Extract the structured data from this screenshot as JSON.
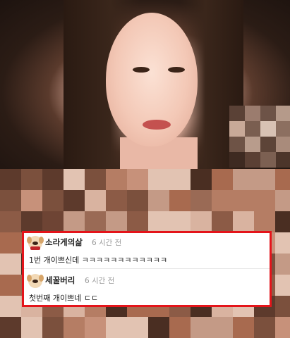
{
  "comments": [
    {
      "username": "소라게의삶",
      "time": "6 시간 전",
      "text": "1번 개이쁘신데 ㅋㅋㅋㅋㅋㅋㅋㅋㅋㅋㅋㅋ"
    },
    {
      "username": "세꿀버리",
      "time": "6 시간 전",
      "text": "첫번째 개이쁘네 ㄷㄷ"
    }
  ],
  "colors": {
    "highlight_border": "#e4141a",
    "comment_bg": "#ffffff",
    "timestamp": "#999999"
  },
  "icons": [
    "dog-avatar-icon",
    "dog-avatar-icon"
  ]
}
